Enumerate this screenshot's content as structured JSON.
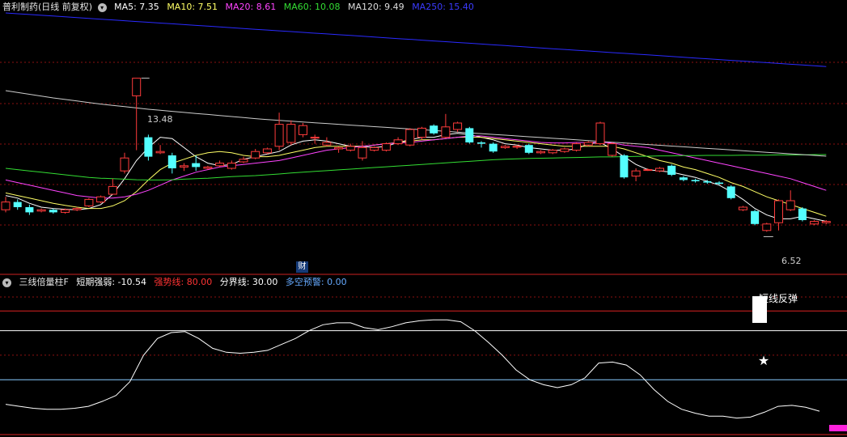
{
  "main_header": {
    "stock": "普利制药(日线 前复权)",
    "ma5": "MA5: 7.35",
    "ma10": "MA10: 7.51",
    "ma20": "MA20: 8.61",
    "ma60": "MA60: 10.08",
    "ma120": "MA120: 9.49",
    "ma250": "MA250: 15.40"
  },
  "colors": {
    "up": "#ff3b3b",
    "down": "#54ffff",
    "ma5": "#ffffff",
    "ma10": "#ffff66",
    "ma20": "#ff44ff",
    "ma60": "#33dd33",
    "ma120": "#cccccc",
    "ma250": "#2a2aff",
    "grid": "#8b1010",
    "divider": "#cc2222"
  },
  "annotations": {
    "high_label": "13.48",
    "low_label": "6.52",
    "event_badge": "财"
  },
  "sub_header": {
    "indicator": "三线倍量柱F",
    "short_strength": "短期强弱: -10.54",
    "strong_line": "强势线: 80.00",
    "boundary": "分界线: 30.00",
    "warning": "多空预警: 0.00"
  },
  "sub_annotation": "短线反弹",
  "chart_data": [
    {
      "type": "candlestick",
      "title": "普利制药(日线 前复权)",
      "ylim": [
        6.0,
        16.0
      ],
      "candles": [
        {
          "o": 8.7,
          "c": 8.4,
          "h": 8.9,
          "l": 8.3,
          "up": true
        },
        {
          "o": 8.7,
          "c": 8.5,
          "h": 8.8,
          "l": 8.4,
          "up": false
        },
        {
          "o": 8.5,
          "c": 8.3,
          "h": 8.6,
          "l": 8.2,
          "up": false
        },
        {
          "o": 8.35,
          "c": 8.4,
          "h": 8.45,
          "l": 8.3,
          "up": true
        },
        {
          "o": 8.4,
          "c": 8.3,
          "h": 8.45,
          "l": 8.25,
          "up": false
        },
        {
          "o": 8.3,
          "c": 8.4,
          "h": 8.45,
          "l": 8.25,
          "up": true
        },
        {
          "o": 8.4,
          "c": 8.45,
          "h": 8.5,
          "l": 8.35,
          "up": true
        },
        {
          "o": 8.55,
          "c": 8.8,
          "h": 8.85,
          "l": 8.5,
          "up": true
        },
        {
          "o": 8.7,
          "c": 8.9,
          "h": 8.95,
          "l": 8.65,
          "up": true
        },
        {
          "o": 9.0,
          "c": 9.3,
          "h": 9.6,
          "l": 9.0,
          "up": true
        },
        {
          "o": 9.9,
          "c": 10.4,
          "h": 10.6,
          "l": 9.8,
          "up": true
        },
        {
          "o": 12.8,
          "c": 13.48,
          "h": 13.48,
          "l": 10.7,
          "up": true
        },
        {
          "o": 11.2,
          "c": 10.45,
          "h": 11.3,
          "l": 10.3,
          "up": false
        },
        {
          "o": 10.6,
          "c": 10.65,
          "h": 10.9,
          "l": 10.55,
          "up": true
        },
        {
          "o": 10.5,
          "c": 10.0,
          "h": 10.6,
          "l": 9.8,
          "up": false
        },
        {
          "o": 10.05,
          "c": 10.1,
          "h": 10.2,
          "l": 9.9,
          "up": true
        },
        {
          "o": 10.2,
          "c": 10.05,
          "h": 10.5,
          "l": 9.9,
          "up": false
        },
        {
          "o": 10.0,
          "c": 10.05,
          "h": 10.1,
          "l": 9.95,
          "up": true
        },
        {
          "o": 10.1,
          "c": 10.2,
          "h": 10.3,
          "l": 10.05,
          "up": true
        },
        {
          "o": 10.0,
          "c": 10.2,
          "h": 10.3,
          "l": 9.95,
          "up": true
        },
        {
          "o": 10.25,
          "c": 10.35,
          "h": 10.45,
          "l": 10.2,
          "up": true
        },
        {
          "o": 10.4,
          "c": 10.65,
          "h": 10.75,
          "l": 10.35,
          "up": true
        },
        {
          "o": 10.6,
          "c": 10.75,
          "h": 10.8,
          "l": 10.55,
          "up": true
        },
        {
          "o": 10.85,
          "c": 11.7,
          "h": 12.15,
          "l": 10.7,
          "up": true
        },
        {
          "o": 11.0,
          "c": 11.7,
          "h": 11.85,
          "l": 10.9,
          "up": true
        },
        {
          "o": 11.3,
          "c": 11.65,
          "h": 11.75,
          "l": 11.2,
          "up": true
        },
        {
          "o": 11.2,
          "c": 11.2,
          "h": 11.3,
          "l": 10.95,
          "up": true
        },
        {
          "o": 10.9,
          "c": 11.0,
          "h": 11.2,
          "l": 10.85,
          "up": true
        },
        {
          "o": 10.8,
          "c": 10.75,
          "h": 10.85,
          "l": 10.6,
          "up": true
        },
        {
          "o": 10.7,
          "c": 10.85,
          "h": 10.95,
          "l": 10.65,
          "up": true
        },
        {
          "o": 10.4,
          "c": 10.8,
          "h": 11.05,
          "l": 10.3,
          "up": true
        },
        {
          "o": 10.7,
          "c": 10.8,
          "h": 10.85,
          "l": 10.65,
          "up": true
        },
        {
          "o": 10.7,
          "c": 10.95,
          "h": 11.0,
          "l": 10.65,
          "up": true
        },
        {
          "o": 10.95,
          "c": 11.1,
          "h": 11.2,
          "l": 10.9,
          "up": true
        },
        {
          "o": 10.9,
          "c": 11.5,
          "h": 11.55,
          "l": 10.85,
          "up": true
        },
        {
          "o": 11.2,
          "c": 11.55,
          "h": 11.6,
          "l": 11.1,
          "up": true
        },
        {
          "o": 11.65,
          "c": 11.35,
          "h": 11.7,
          "l": 11.3,
          "up": false
        },
        {
          "o": 11.2,
          "c": 11.6,
          "h": 12.1,
          "l": 11.15,
          "up": true
        },
        {
          "o": 11.5,
          "c": 11.75,
          "h": 11.8,
          "l": 11.4,
          "up": true
        },
        {
          "o": 11.55,
          "c": 11.0,
          "h": 11.6,
          "l": 10.95,
          "up": false
        },
        {
          "o": 11.0,
          "c": 10.95,
          "h": 11.05,
          "l": 10.8,
          "up": false
        },
        {
          "o": 10.95,
          "c": 10.65,
          "h": 11.0,
          "l": 10.6,
          "up": false
        },
        {
          "o": 10.8,
          "c": 10.85,
          "h": 10.9,
          "l": 10.75,
          "up": true
        },
        {
          "o": 10.85,
          "c": 10.85,
          "h": 10.9,
          "l": 10.75,
          "up": true
        },
        {
          "o": 10.9,
          "c": 10.6,
          "h": 10.95,
          "l": 10.55,
          "up": false
        },
        {
          "o": 10.6,
          "c": 10.65,
          "h": 10.7,
          "l": 10.55,
          "up": true
        },
        {
          "o": 10.6,
          "c": 10.7,
          "h": 10.75,
          "l": 10.55,
          "up": true
        },
        {
          "o": 10.65,
          "c": 10.75,
          "h": 10.8,
          "l": 10.6,
          "up": true
        },
        {
          "o": 10.7,
          "c": 10.95,
          "h": 11.0,
          "l": 10.65,
          "up": true
        },
        {
          "o": 11.0,
          "c": 10.9,
          "h": 11.05,
          "l": 10.85,
          "up": true
        },
        {
          "o": 10.95,
          "c": 11.75,
          "h": 11.8,
          "l": 10.9,
          "up": true
        },
        {
          "o": 10.95,
          "c": 10.5,
          "h": 11.0,
          "l": 10.45,
          "up": true
        },
        {
          "o": 10.5,
          "c": 9.65,
          "h": 10.55,
          "l": 9.6,
          "up": false
        },
        {
          "o": 9.7,
          "c": 9.9,
          "h": 10.0,
          "l": 9.5,
          "up": true
        },
        {
          "o": 9.95,
          "c": 9.95,
          "h": 10.0,
          "l": 9.9,
          "up": true
        },
        {
          "o": 9.9,
          "c": 10.0,
          "h": 10.05,
          "l": 9.85,
          "up": true
        },
        {
          "o": 10.1,
          "c": 9.75,
          "h": 10.15,
          "l": 9.7,
          "up": false
        },
        {
          "o": 9.65,
          "c": 9.55,
          "h": 9.7,
          "l": 9.5,
          "up": false
        },
        {
          "o": 9.55,
          "c": 9.5,
          "h": 9.6,
          "l": 9.45,
          "up": false
        },
        {
          "o": 9.5,
          "c": 9.45,
          "h": 9.55,
          "l": 9.4,
          "up": false
        },
        {
          "o": 9.45,
          "c": 9.4,
          "h": 9.5,
          "l": 9.35,
          "up": false
        },
        {
          "o": 9.3,
          "c": 8.85,
          "h": 9.35,
          "l": 8.8,
          "up": false
        },
        {
          "o": 8.4,
          "c": 8.5,
          "h": 8.55,
          "l": 8.35,
          "up": true
        },
        {
          "o": 8.35,
          "c": 7.85,
          "h": 8.4,
          "l": 7.8,
          "up": false
        },
        {
          "o": 7.6,
          "c": 7.85,
          "h": 7.9,
          "l": 7.55,
          "up": true
        },
        {
          "o": 7.9,
          "c": 8.75,
          "h": 8.8,
          "l": 7.6,
          "up": true
        },
        {
          "o": 8.4,
          "c": 8.75,
          "h": 9.15,
          "l": 8.35,
          "up": true
        },
        {
          "o": 8.45,
          "c": 8.0,
          "h": 8.5,
          "l": 7.95,
          "up": false
        },
        {
          "o": 7.85,
          "c": 7.95,
          "h": 8.0,
          "l": 7.8,
          "up": true
        },
        {
          "o": 7.9,
          "c": 7.95,
          "h": 8.0,
          "l": 7.85,
          "up": true
        }
      ],
      "ma_series": [
        {
          "name": "MA5",
          "values": [
            8.95,
            8.85,
            8.65,
            8.5,
            8.45,
            8.42,
            8.4,
            8.45,
            8.6,
            9.0,
            9.6,
            10.3,
            10.8,
            11.2,
            11.15,
            10.8,
            10.45,
            10.2,
            10.1,
            10.15,
            10.35,
            10.45,
            10.55,
            10.65,
            10.9,
            11.05,
            11.1,
            11.05,
            10.95,
            10.85,
            10.85,
            10.8,
            10.85,
            11.0,
            11.1,
            11.2,
            11.2,
            11.3,
            11.35,
            11.3,
            11.2,
            11.1,
            10.95,
            10.9,
            10.8,
            10.75,
            10.7,
            10.7,
            10.75,
            10.95,
            11.0,
            10.75,
            10.45,
            10.15,
            9.95,
            9.9,
            9.85,
            9.75,
            9.65,
            9.5,
            9.35,
            9.1,
            8.8,
            8.45,
            8.2,
            8.05,
            8.05,
            8.15,
            8.05,
            7.95
          ]
        },
        {
          "name": "MA10",
          "values": [
            9.05,
            8.95,
            8.85,
            8.75,
            8.65,
            8.57,
            8.5,
            8.45,
            8.45,
            8.55,
            8.75,
            9.1,
            9.55,
            9.95,
            10.2,
            10.35,
            10.5,
            10.6,
            10.65,
            10.6,
            10.5,
            10.45,
            10.45,
            10.5,
            10.6,
            10.7,
            10.8,
            10.85,
            10.85,
            10.85,
            10.85,
            10.9,
            10.95,
            11.0,
            11.05,
            11.1,
            11.1,
            11.15,
            11.2,
            11.2,
            11.2,
            11.15,
            11.1,
            11.05,
            11.0,
            10.95,
            10.9,
            10.85,
            10.85,
            10.85,
            10.85,
            10.85,
            10.75,
            10.6,
            10.45,
            10.3,
            10.2,
            10.05,
            9.95,
            9.8,
            9.65,
            9.45,
            9.3,
            9.1,
            8.9,
            8.75,
            8.6,
            8.45,
            8.3,
            8.15
          ]
        },
        {
          "name": "MA20",
          "values": [
            9.55,
            9.45,
            9.35,
            9.25,
            9.15,
            9.05,
            8.95,
            8.9,
            8.85,
            8.85,
            8.9,
            9.0,
            9.15,
            9.35,
            9.55,
            9.7,
            9.85,
            9.95,
            10.05,
            10.1,
            10.15,
            10.2,
            10.25,
            10.3,
            10.4,
            10.5,
            10.6,
            10.7,
            10.75,
            10.8,
            10.85,
            10.9,
            10.95,
            10.98,
            11.0,
            11.05,
            11.1,
            11.15,
            11.2,
            11.25,
            11.25,
            11.2,
            11.15,
            11.1,
            11.05,
            11.0,
            10.98,
            10.98,
            11.0,
            11.0,
            11.0,
            10.98,
            10.9,
            10.85,
            10.8,
            10.7,
            10.6,
            10.5,
            10.4,
            10.3,
            10.2,
            10.1,
            10.0,
            9.9,
            9.8,
            9.7,
            9.6,
            9.45,
            9.3,
            9.15
          ]
        },
        {
          "name": "MA60",
          "values": [
            10.0,
            9.95,
            9.9,
            9.85,
            9.8,
            9.75,
            9.7,
            9.65,
            9.62,
            9.6,
            9.58,
            9.56,
            9.55,
            9.55,
            9.56,
            9.58,
            9.6,
            9.62,
            9.65,
            9.68,
            9.7,
            9.72,
            9.75,
            9.78,
            9.82,
            9.85,
            9.88,
            9.91,
            9.94,
            9.97,
            10.0,
            10.03,
            10.06,
            10.09,
            10.12,
            10.15,
            10.18,
            10.21,
            10.24,
            10.27,
            10.3,
            10.33,
            10.35,
            10.37,
            10.38,
            10.39,
            10.4,
            10.41,
            10.42,
            10.43,
            10.44,
            10.44,
            10.45,
            10.46,
            10.47,
            10.48,
            10.48,
            10.49,
            10.49,
            10.5,
            10.5,
            10.5,
            10.51,
            10.51,
            10.51,
            10.52,
            10.52,
            10.52,
            10.53,
            10.53
          ]
        },
        {
          "name": "MA120",
          "values": [
            13.0,
            12.93,
            12.86,
            12.79,
            12.72,
            12.66,
            12.6,
            12.54,
            12.48,
            12.43,
            12.38,
            12.33,
            12.28,
            12.24,
            12.2,
            12.16,
            12.12,
            12.08,
            12.04,
            12.0,
            11.96,
            11.92,
            11.88,
            11.85,
            11.82,
            11.79,
            11.76,
            11.73,
            11.7,
            11.67,
            11.64,
            11.61,
            11.58,
            11.55,
            11.52,
            11.49,
            11.46,
            11.43,
            11.4,
            11.37,
            11.34,
            11.31,
            11.28,
            11.25,
            11.22,
            11.19,
            11.16,
            11.13,
            11.1,
            11.07,
            11.04,
            11.01,
            10.98,
            10.95,
            10.92,
            10.89,
            10.86,
            10.83,
            10.8,
            10.77,
            10.74,
            10.71,
            10.68,
            10.65,
            10.62,
            10.59,
            10.56,
            10.53,
            10.5,
            10.47
          ]
        },
        {
          "name": "MA250",
          "values": [
            16.0,
            15.97,
            15.94,
            15.91,
            15.88,
            15.85,
            15.82,
            15.79,
            15.76,
            15.73,
            15.7,
            15.67,
            15.64,
            15.61,
            15.58,
            15.55,
            15.52,
            15.49,
            15.46,
            15.43,
            15.4,
            15.37,
            15.34,
            15.31,
            15.28,
            15.25,
            15.22,
            15.19,
            15.16,
            15.13,
            15.1,
            15.07,
            15.04,
            15.01,
            14.98,
            14.95,
            14.92,
            14.89,
            14.86,
            14.83,
            14.8,
            14.77,
            14.74,
            14.71,
            14.68,
            14.65,
            14.62,
            14.59,
            14.56,
            14.53,
            14.5,
            14.47,
            14.44,
            14.41,
            14.38,
            14.35,
            14.32,
            14.29,
            14.26,
            14.23,
            14.2,
            14.17,
            14.14,
            14.11,
            14.08,
            14.05,
            14.02,
            13.99,
            13.96,
            13.93
          ]
        }
      ]
    },
    {
      "type": "line",
      "title": "三线倍量柱F",
      "ylim": [
        -20,
        120
      ],
      "levels": [
        100,
        80,
        30
      ],
      "series": [
        {
          "name": "短期强弱",
          "values": [
            5,
            3,
            1,
            0,
            0,
            1,
            3,
            8,
            14,
            28,
            55,
            72,
            78,
            79,
            72,
            62,
            58,
            57,
            58,
            60,
            66,
            72,
            80,
            86,
            88,
            88,
            83,
            81,
            84,
            88,
            90,
            91,
            91,
            89,
            80,
            68,
            55,
            40,
            30,
            25,
            22,
            25,
            32,
            47,
            48,
            45,
            35,
            20,
            8,
            0,
            -4,
            -7,
            -7,
            -9,
            -8,
            -3,
            3,
            4,
            2,
            -2
          ]
        }
      ],
      "columns": {
        "white_bar": {
          "index": 64,
          "value": 100
        },
        "star": {
          "index": 64,
          "value": 80
        },
        "magenta_band": {
          "from": 59,
          "to": 66
        }
      }
    }
  ]
}
